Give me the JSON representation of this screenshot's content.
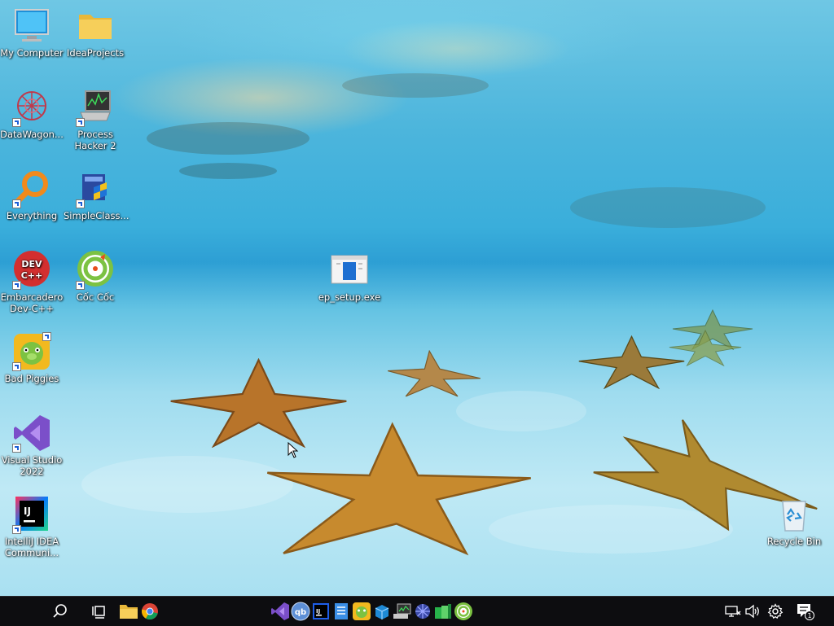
{
  "desktop": {
    "icons": [
      {
        "name": "My Computer",
        "label": "My Computer"
      },
      {
        "name": "IdeaProjects",
        "label": "IdeaProjects"
      },
      {
        "name": "DataWagon",
        "label": "DataWagon..."
      },
      {
        "name": "Process Hacker 2",
        "label": "Process Hacker 2"
      },
      {
        "name": "Everything",
        "label": "Everything"
      },
      {
        "name": "SimpleClass",
        "label": "SimpleClass..."
      },
      {
        "name": "Embarcadero Dev-C++",
        "label": "Embarcadero Dev-C++",
        "logo": "DEV C++"
      },
      {
        "name": "Coc Coc",
        "label": "Cốc Cốc"
      },
      {
        "name": "ep_setup.exe",
        "label": "ep_setup.exe"
      },
      {
        "name": "Bad Piggies",
        "label": "Bad Piggies"
      },
      {
        "name": "Visual Studio 2022",
        "label": "Visual Studio 2022"
      },
      {
        "name": "IntelliJ IDEA Community",
        "label": "IntelliJ IDEA Communi...",
        "logo": "IJ"
      },
      {
        "name": "Recycle Bin",
        "label": "Recycle Bin"
      }
    ]
  },
  "taskbar": {
    "pinned_icons": [
      "folder-icon",
      "chrome-icon",
      "visual-studio-icon",
      "qbittorrent-icon",
      "intellij-icon",
      "notepad-icon",
      "bad-piggies-icon",
      "virtualbox-icon",
      "network-monitor-icon",
      "globe-icon",
      "green-app-icon",
      "coc-coc-icon"
    ],
    "qb_label": "qb",
    "ij_label": "IJ",
    "notification_count": "1"
  },
  "colors": {
    "taskbar_bg": "#0d0d10",
    "water_top": "#6fc7e4",
    "sand": "#bfe9f5"
  }
}
